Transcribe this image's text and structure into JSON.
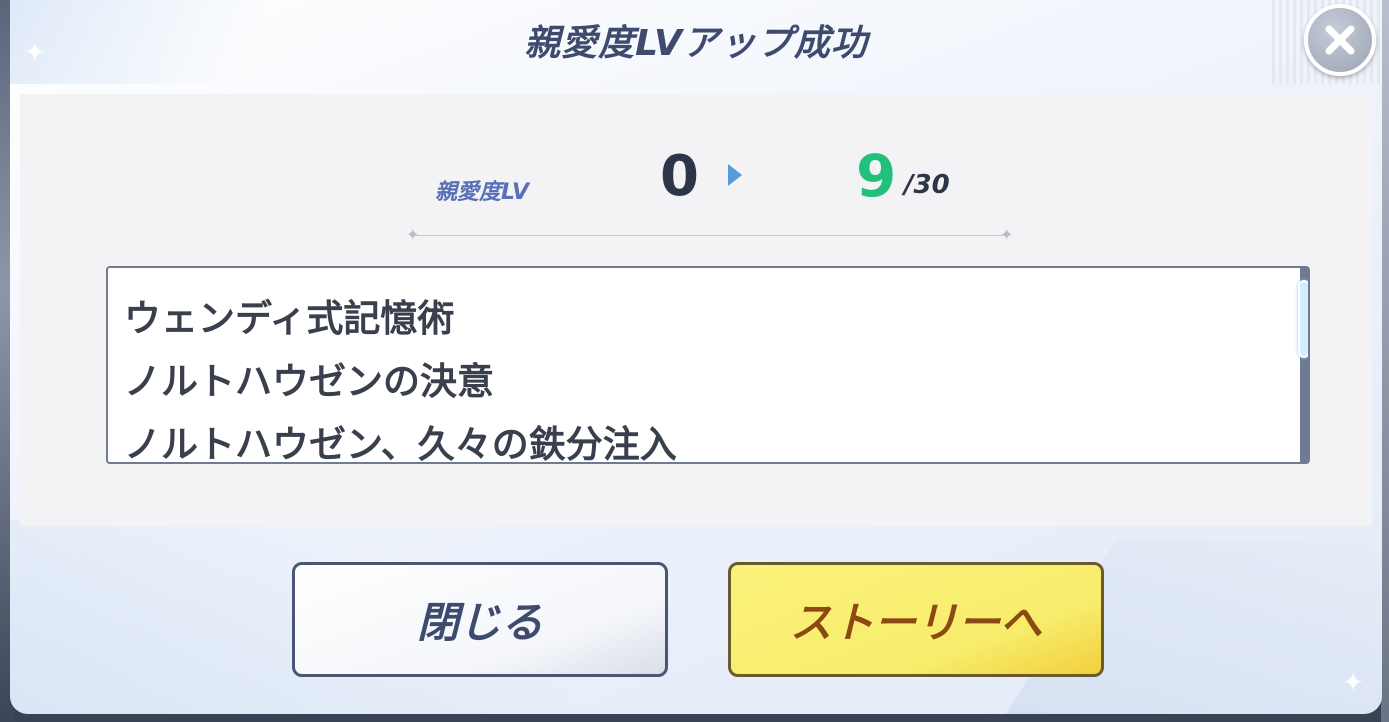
{
  "dialog": {
    "title": "親愛度LVアップ成功",
    "close_icon": "close-x-icon"
  },
  "level": {
    "label": "親愛度LV",
    "old_value": "0",
    "new_value": "9",
    "max_value": "/30"
  },
  "unlocked_items": [
    "ウェンディ式記憶術",
    "ノルトハウゼンの決意",
    "ノルトハウゼン、久々の鉄分注入"
  ],
  "buttons": {
    "close_label": "閉じる",
    "story_label": "ストーリーへ"
  },
  "colors": {
    "title": "#3e4a6e",
    "new_level": "#22c07a",
    "story_button": "#f7ec6b",
    "story_text": "#8a4a12"
  }
}
